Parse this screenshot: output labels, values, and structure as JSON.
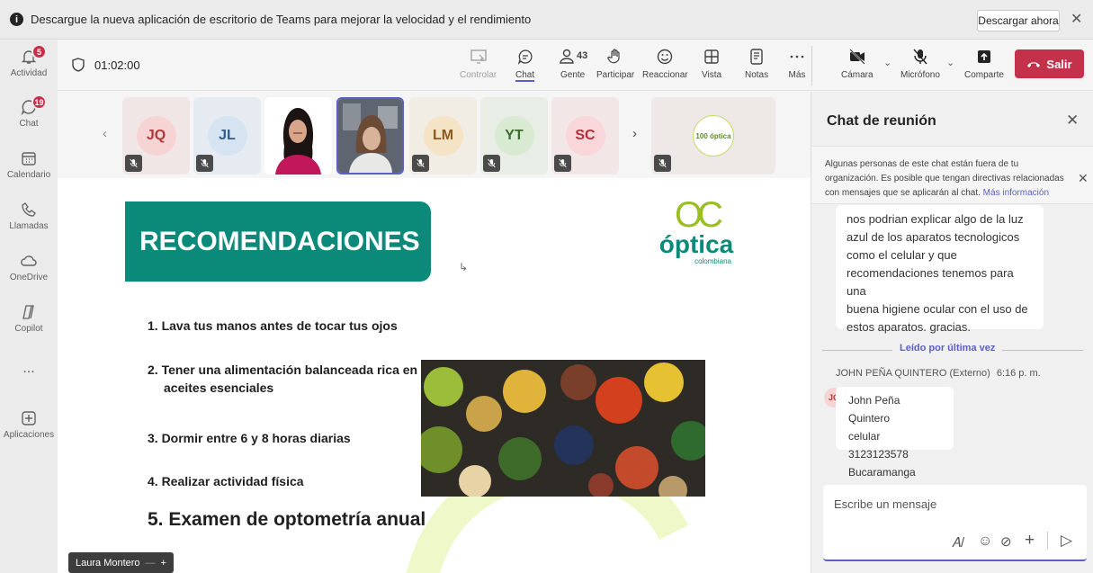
{
  "banner": {
    "text": "Descargue la nueva aplicación de escritorio de Teams para mejorar la velocidad y el rendimiento",
    "download": "Descargar ahora",
    "close": "✕"
  },
  "rail": {
    "items": [
      {
        "label": "Actividad",
        "badge": "5"
      },
      {
        "label": "Chat",
        "badge": "19"
      },
      {
        "label": "Calendario"
      },
      {
        "label": "Llamadas"
      },
      {
        "label": "OneDrive"
      },
      {
        "label": "Copilot"
      },
      {
        "label": "..."
      },
      {
        "label": "Aplicaciones"
      }
    ]
  },
  "meeting": {
    "timer": "01:02:00",
    "controls": {
      "controlar": "Controlar",
      "chat": "Chat",
      "gente": "Gente",
      "gente_count": "43",
      "participar": "Participar",
      "reaccionar": "Reaccionar",
      "vista": "Vista",
      "notas": "Notas",
      "mas": "Más",
      "camara": "Cámara",
      "microfono": "Micrófono",
      "comparte": "Comparte",
      "salir": "Salir"
    }
  },
  "participants": [
    {
      "initials": "JQ",
      "color": "#f7d4d4",
      "text_color": "#b03a3a"
    },
    {
      "initials": "JL",
      "color": "#d6e4f2",
      "text_color": "#2f5d8a"
    },
    {
      "initials": "LM",
      "color": "#f5e3c6",
      "text_color": "#8a5a1e"
    },
    {
      "initials": "YT",
      "color": "#d9ead3",
      "text_color": "#3d6b2f"
    },
    {
      "initials": "SC",
      "color": "#f9d6d9",
      "text_color": "#b0303c"
    }
  ],
  "slide": {
    "title": "RECOMENDACIONES",
    "brand": "óptica",
    "brand_sub": "colombiana",
    "logo_mark": "OC",
    "badge_text": "100 óptica",
    "items": [
      "1. Lava tus manos antes de tocar tus ojos",
      "2. Tener una alimentación balanceada rica en",
      "aceites esenciales",
      "3. Dormir entre 6 y 8 horas diarias",
      "4. Realizar actividad física",
      "5. Examen de optometría anual"
    ]
  },
  "presenter": {
    "name": "Laura Montero"
  },
  "chat": {
    "title": "Chat de reunión",
    "notice": "Algunas personas de este chat están fuera de tu organización. Es posible que tengan directivas relacionadas con mensajes que se aplicarán al chat.",
    "notice_link": "Más información",
    "msg1": [
      "nos podrian explicar algo de la luz",
      "azul de los aparatos tecnologicos",
      "como el celular y que",
      "recomendaciones tenemos para una",
      "buena higiene ocular con el uso de",
      "estos aparatos. gracias."
    ],
    "read_divider": "Leído por última vez",
    "sender": "JOHN PEÑA QUINTERO (Externo)",
    "time": "6:16 p. m.",
    "sender_initials": "JQ",
    "msg2": [
      "John Peña Quintero",
      "celular 3123123578",
      "Bucaramanga"
    ],
    "placeholder": "Escribe un mensaje"
  }
}
